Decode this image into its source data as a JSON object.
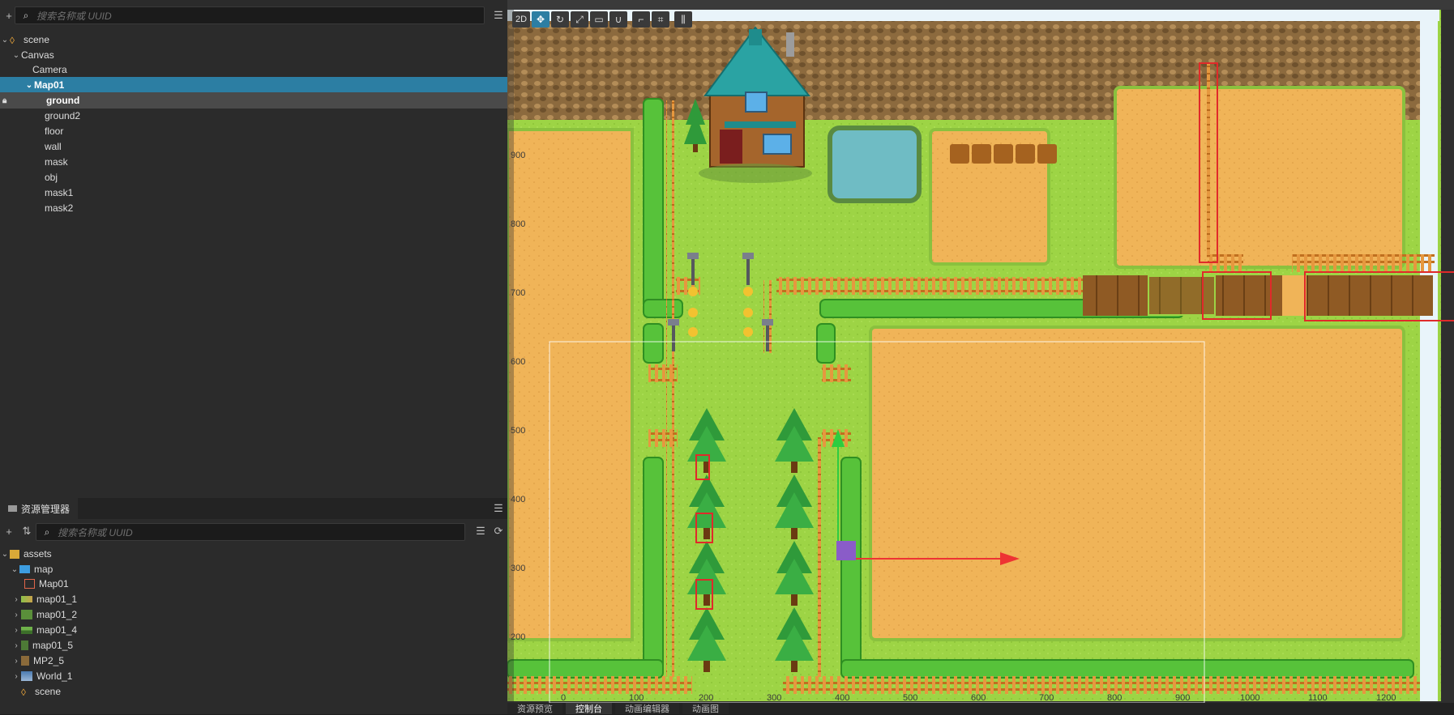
{
  "hierarchy": {
    "search_placeholder": "搜索名称或 UUID",
    "nodes": [
      {
        "label": "scene"
      },
      {
        "label": "Canvas"
      },
      {
        "label": "Camera"
      },
      {
        "label": "Map01"
      },
      {
        "label": "ground"
      },
      {
        "label": "ground2"
      },
      {
        "label": "floor"
      },
      {
        "label": "wall"
      },
      {
        "label": "mask"
      },
      {
        "label": "obj"
      },
      {
        "label": "mask1"
      },
      {
        "label": "mask2"
      }
    ]
  },
  "assets": {
    "title": "资源管理器",
    "search_placeholder": "搜索名称或 UUID",
    "items": [
      {
        "label": "assets"
      },
      {
        "label": "map"
      },
      {
        "label": "Map01"
      },
      {
        "label": "map01_1"
      },
      {
        "label": "map01_2"
      },
      {
        "label": "map01_4"
      },
      {
        "label": "map01_5"
      },
      {
        "label": "MP2_5"
      },
      {
        "label": "World_1"
      },
      {
        "label": "scene"
      }
    ]
  },
  "scene_view": {
    "toolbar": {
      "mode_2d": "2D"
    },
    "ruler_y": [
      "900",
      "800",
      "700",
      "600",
      "500",
      "400",
      "300",
      "200"
    ],
    "ruler_x": [
      "0",
      "100",
      "200",
      "300",
      "400",
      "500",
      "600",
      "700",
      "800",
      "900",
      "1000",
      "1100",
      "1200"
    ]
  },
  "bottom_tabs": [
    {
      "label": "资源预览"
    },
    {
      "label": "控制台"
    },
    {
      "label": "动画编辑器"
    },
    {
      "label": "动画图"
    }
  ]
}
